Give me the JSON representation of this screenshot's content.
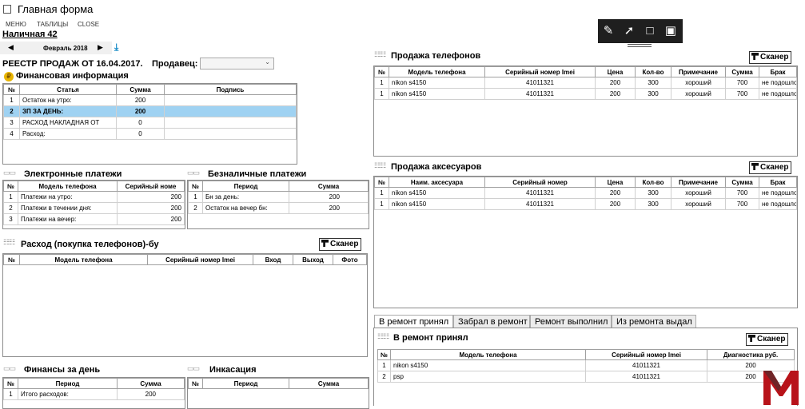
{
  "window": {
    "title": "Главная форма"
  },
  "menu": {
    "items": [
      "МЕНЮ",
      "ТАБЛИЦЫ",
      "CLOSE"
    ]
  },
  "store": {
    "name": "Наличная 42"
  },
  "date_nav": {
    "month": "Февраль 2018"
  },
  "registry": {
    "title": "РЕЕСТР ПРОДАЖ ОТ 16.04.2017.",
    "seller_label": "Продавец:",
    "seller_value": ""
  },
  "scanner_label": "Сканер",
  "fin_info": {
    "title": "Финансовая информация",
    "headers": [
      "№",
      "Статья",
      "Сумма",
      "Подпись"
    ],
    "rows": [
      [
        "1",
        "Остаток на утро:",
        "200",
        ""
      ],
      [
        "2",
        "ЗП ЗА ДЕНЬ:",
        "200",
        ""
      ],
      [
        "3",
        "РАСХОД НАКЛАДНАЯ ОТ",
        "0",
        ""
      ],
      [
        "4",
        "Расход:",
        "0",
        ""
      ]
    ]
  },
  "e_payments": {
    "title": "Электронные платежи",
    "headers": [
      "№",
      "Модель телефона",
      "Серийный номе"
    ],
    "rows": [
      [
        "1",
        "Платежи на утро:",
        "200"
      ],
      [
        "2",
        "Платежи в течении дня:",
        "200"
      ],
      [
        "3",
        "Платежи на вечер:",
        "200"
      ]
    ]
  },
  "cashless": {
    "title": "Безналичные платежи",
    "headers": [
      "№",
      "Период",
      "Сумма"
    ],
    "rows": [
      [
        "1",
        "Бн за день:",
        "200"
      ],
      [
        "2",
        "Остаток на вечер бн:",
        "200"
      ]
    ]
  },
  "expense": {
    "title": "Расход (покупка телефонов)-бу",
    "headers": [
      "№",
      "Модель телефона",
      "Серийный номер Imei",
      "Вход",
      "Выход",
      "Фото"
    ]
  },
  "fin_day": {
    "title": "Финансы за день",
    "headers": [
      "№",
      "Период",
      "Сумма"
    ],
    "rows": [
      [
        "1",
        "Итого расходов:",
        "200"
      ]
    ]
  },
  "encashment": {
    "title": "Инкасация",
    "headers": [
      "№",
      "Период",
      "Сумма"
    ]
  },
  "phone_sales": {
    "title": "Продажа телефонов",
    "headers": [
      "№",
      "Модель телефона",
      "Серийный номер Imei",
      "Цена",
      "Кол-во",
      "Примечание",
      "Сумма",
      "Брак"
    ],
    "rows": [
      [
        "1",
        "nikon s4150",
        "41011321",
        "200",
        "300",
        "хороший",
        "700",
        "не подошло"
      ],
      [
        "1",
        "nikon s4150",
        "41011321",
        "200",
        "300",
        "хороший",
        "700",
        "не подошло"
      ]
    ]
  },
  "acc_sales": {
    "title": "Продажа аксесуаров",
    "headers": [
      "№",
      "Наим. аксесуара",
      "Серийный номер",
      "Цена",
      "Кол-во",
      "Примечание",
      "Сумма",
      "Брак"
    ],
    "rows": [
      [
        "1",
        "nikon s4150",
        "41011321",
        "200",
        "300",
        "хороший",
        "700",
        "не подошло"
      ],
      [
        "1",
        "nikon s4150",
        "41011321",
        "200",
        "300",
        "хороший",
        "700",
        "не подошло"
      ]
    ]
  },
  "repair": {
    "tabs": [
      "В ремонт принял",
      "Забрал в ремонт",
      "Ремонт выполнил",
      "Из ремонта выдал"
    ],
    "title": "В ремонт принял",
    "headers": [
      "№",
      "Модель телефона",
      "Серийный номер Imei",
      "Диагностика руб."
    ],
    "rows": [
      [
        "1",
        "nikon s4150",
        "41011321",
        "200"
      ],
      [
        "2",
        "psp",
        "41011321",
        "200"
      ]
    ]
  },
  "colors": {
    "selected_row": "#9fd2f2",
    "toolbar": "#1f1f1f",
    "logo": "#b8131a"
  }
}
